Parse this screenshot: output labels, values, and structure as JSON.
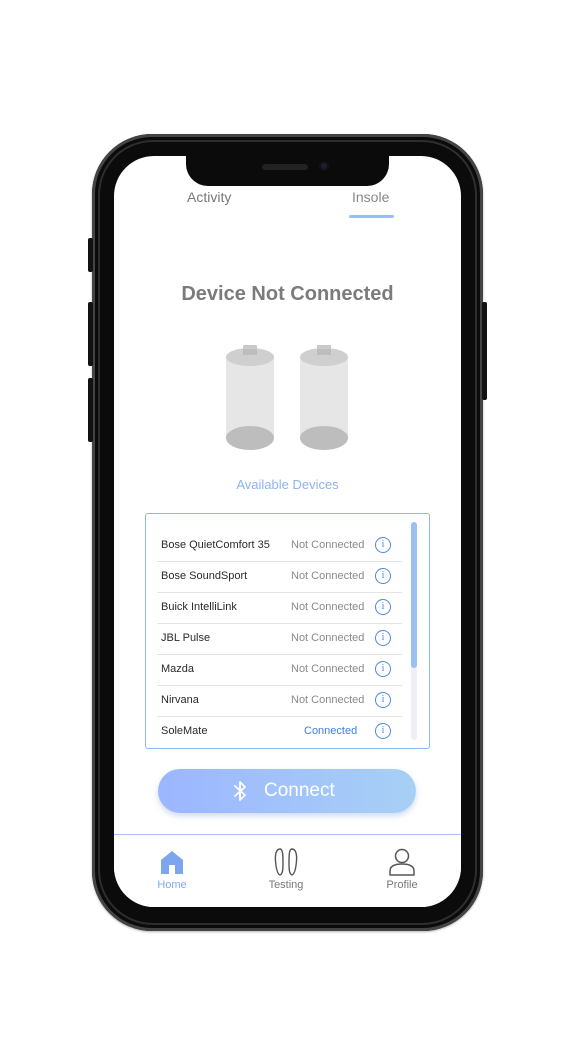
{
  "tabs": [
    {
      "label": "Activity"
    },
    {
      "label": "Insole",
      "active": true
    }
  ],
  "status": {
    "title": "Device Not Connected",
    "battery_icons": [
      "battery-icon",
      "battery-icon"
    ]
  },
  "devices": {
    "header": "Available Devices",
    "items": [
      {
        "name": "Bose QuietComfort 35",
        "status": "Not Connected"
      },
      {
        "name": "Bose SoundSport",
        "status": "Not Connected"
      },
      {
        "name": "Buick IntelliLink",
        "status": "Not Connected"
      },
      {
        "name": "JBL Pulse",
        "status": "Not Connected"
      },
      {
        "name": "Mazda",
        "status": "Not Connected"
      },
      {
        "name": "Nirvana",
        "status": "Not Connected"
      },
      {
        "name": "SoleMate",
        "status": "Connected"
      }
    ],
    "info_glyph": "i"
  },
  "connect_button": {
    "label": "Connect",
    "icon": "bluetooth-icon"
  },
  "bottom_nav": {
    "items": [
      {
        "label": "Home",
        "icon": "home-icon",
        "active": true
      },
      {
        "label": "Testing",
        "icon": "footprints-icon"
      },
      {
        "label": "Profile",
        "icon": "user-icon"
      }
    ]
  },
  "colors": {
    "accent": "#8fb2ef",
    "connected": "#3d7ee6",
    "button_start": "#9cb6ff",
    "button_end": "#a7d0f5"
  }
}
